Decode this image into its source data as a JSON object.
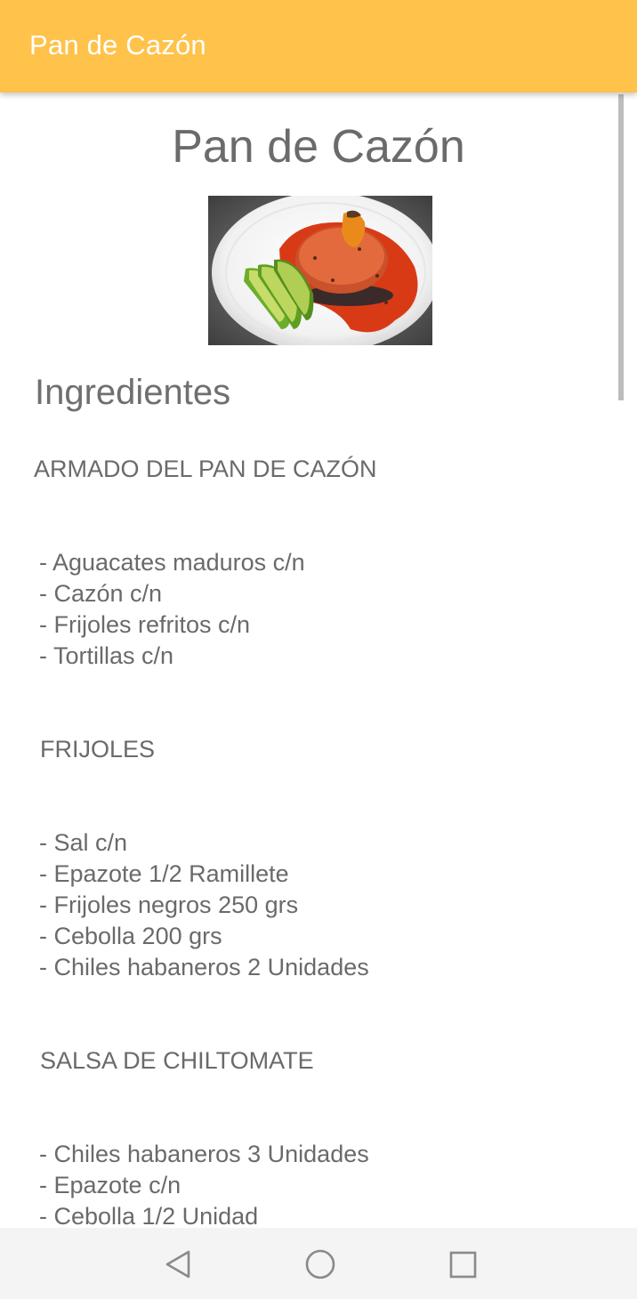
{
  "appbar": {
    "title": "Pan de Cazón"
  },
  "recipe": {
    "title": "Pan de Cazón",
    "ingredients_heading": "Ingredientes",
    "groups": [
      {
        "label": "ARMADO DEL PAN DE CAZÓN",
        "items": [
          "- Aguacates maduros c/n",
          "- Cazón c/n",
          "- Frijoles refritos c/n",
          "- Tortillas c/n"
        ]
      },
      {
        "label": "FRIJOLES",
        "items": [
          "- Sal c/n",
          "- Epazote 1/2 Ramillete",
          "- Frijoles negros 250 grs",
          "- Cebolla 200 grs",
          "- Chiles habaneros 2 Unidades"
        ]
      },
      {
        "label": "SALSA DE CHILTOMATE",
        "items": [
          "- Chiles habaneros 3 Unidades",
          "- Epazote c/n",
          "- Cebolla 1/2 Unidad"
        ]
      }
    ]
  },
  "navigation": {
    "back_icon": "back-triangle-icon",
    "home_icon": "home-circle-icon",
    "recents_icon": "recents-square-icon"
  },
  "colors": {
    "appbar": "#FFC24A",
    "text": "#6a6a6a"
  }
}
